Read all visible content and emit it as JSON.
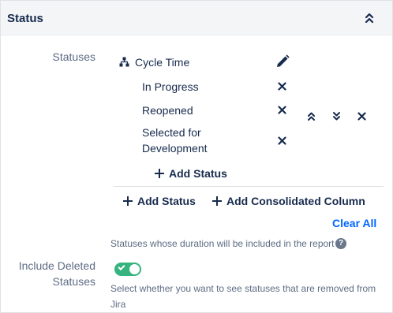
{
  "section": {
    "title": "Status"
  },
  "statuses": {
    "label": "Statuses",
    "group": {
      "name": "Cycle Time",
      "items": [
        {
          "label": "In Progress"
        },
        {
          "label": "Reopened"
        },
        {
          "label_line1": "Selected for",
          "label_line2": "Development"
        }
      ],
      "add_status_label": "Add Status"
    },
    "add_status_label": "Add Status",
    "add_consolidated_label": "Add Consolidated Column",
    "clear_all_label": "Clear All",
    "help_text": "Statuses whose duration will be included in the report",
    "info_glyph": "?"
  },
  "include_deleted": {
    "label_line1": "Include Deleted",
    "label_line2": "Statuses",
    "enabled": true,
    "help_line1": "Select whether you want to see statuses that are removed from",
    "help_line2": "Jira"
  },
  "colors": {
    "toggle_on": "#36b37e",
    "link": "#0065ff",
    "text": "#172b4d",
    "label": "#5e6c84"
  }
}
